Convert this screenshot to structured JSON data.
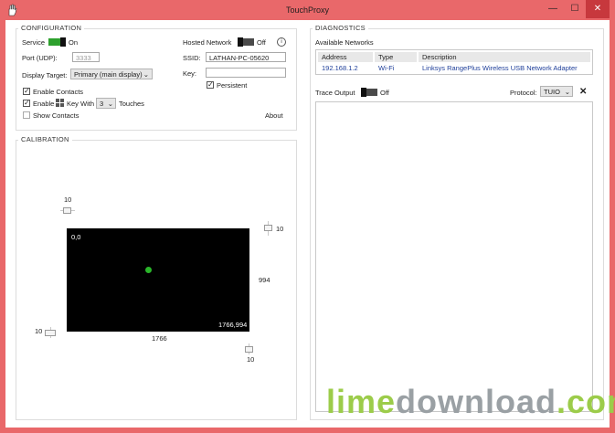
{
  "window": {
    "title": "TouchProxy",
    "minimize_glyph": "—",
    "maximize_glyph": "☐",
    "close_glyph": "✕",
    "app_icon": "hand-icon",
    "close_color": "#c7383d",
    "frame_color": "#e9686a"
  },
  "configuration": {
    "title": "CONFIGURATION",
    "service_label": "Service",
    "service_state": "On",
    "port_label": "Port (UDP):",
    "port_value": "3333",
    "display_target_label": "Display Target:",
    "display_target_value": "Primary (main display)",
    "enable_contacts_label": "Enable Contacts",
    "enable_label": "Enable",
    "key_with_label": "Key With",
    "touches_count": "3",
    "touches_label": "Touches",
    "show_contacts_label": "Show Contacts",
    "hosted_network_label": "Hosted Network",
    "hosted_network_state": "Off",
    "ssid_label": "SSID:",
    "ssid_value": "LATHAN-PC-05620",
    "key_label": "Key:",
    "key_value": "",
    "persistent_label": "Persistent",
    "about_label": "About",
    "info_glyph": "i",
    "accent_on": "#2da02d"
  },
  "calibration": {
    "title": "CALIBRATION",
    "top_offset": "10",
    "right_offset": "10",
    "left_offset": "10",
    "bottom_offset": "10",
    "width_value": "1766",
    "height_value": "994",
    "origin_label": "0,0",
    "extent_label": "1766,994"
  },
  "diagnostics": {
    "title": "DIAGNOSTICS",
    "networks_label": "Available Networks",
    "columns": [
      "Address",
      "Type",
      "Description"
    ],
    "rows": [
      {
        "address": "192.168.1.2",
        "type": "Wi-Fi",
        "description": "Linksys RangePlus Wireless USB Network Adapter"
      }
    ],
    "trace_output_label": "Trace Output",
    "trace_state": "Off",
    "protocol_label": "Protocol:",
    "protocol_value": "TUIO",
    "clear_glyph": "✕"
  },
  "watermark": {
    "part1": "lime",
    "part2": "download",
    "part3": ".com"
  }
}
